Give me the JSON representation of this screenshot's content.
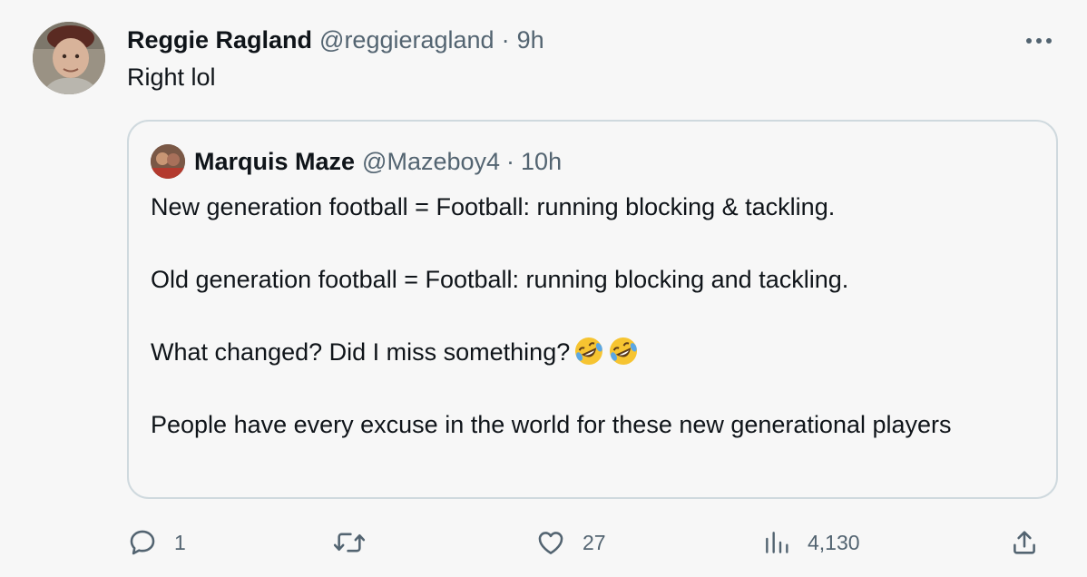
{
  "tweet": {
    "display_name": "Reggie Ragland",
    "handle": "@reggieragland",
    "separator": "·",
    "time": "9h",
    "text": "Right lol"
  },
  "quoted_tweet": {
    "display_name": "Marquis Maze",
    "handle": "@Mazeboy4",
    "separator": "·",
    "time": "10h",
    "paragraphs": [
      "New generation football = Football: running blocking & tackling.",
      "Old generation football = Football: running blocking and tackling.",
      "What changed? Did I miss something?",
      "People have every excuse in the world for these new generational players"
    ],
    "emojis": [
      "rolling-on-floor-laughing",
      "rolling-on-floor-laughing"
    ]
  },
  "actions": {
    "reply_count": "1",
    "retweet_count": "",
    "like_count": "27",
    "view_count": "4,130"
  },
  "icons": {
    "more": "more-icon",
    "reply": "reply-icon",
    "retweet": "retweet-icon",
    "like": "like-icon",
    "views": "views-icon",
    "share": "share-icon"
  },
  "colors": {
    "background": "#f7f7f7",
    "text": "#0f1419",
    "secondary": "#536471",
    "border": "#cfd9de"
  }
}
